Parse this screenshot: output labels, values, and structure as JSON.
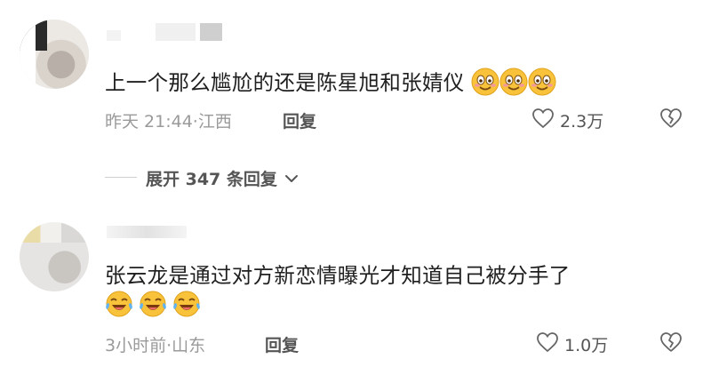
{
  "comments": [
    {
      "text": "上一个那么尴尬的还是陈星旭和张婧仪",
      "emojis": [
        "smile-emoji",
        "smile-emoji",
        "smile-emoji"
      ],
      "time": "昨天 21:44",
      "location": "江西",
      "reply_label": "回复",
      "likes": "2.3万",
      "expand_label": "展开 347 条回复"
    },
    {
      "text": "张云龙是通过对方新恋情曝光才知道自己被分手了",
      "emojis": [
        "laugh-cry-emoji",
        "laugh-cry-emoji",
        "laugh-cry-emoji"
      ],
      "time": "3小时前",
      "location": "山东",
      "reply_label": "回复",
      "likes": "1.0万"
    }
  ],
  "colors": {
    "text": "#1f1f1f",
    "meta": "#9a9a9a",
    "secondary": "#555555",
    "emoji": "#f8c23a"
  }
}
